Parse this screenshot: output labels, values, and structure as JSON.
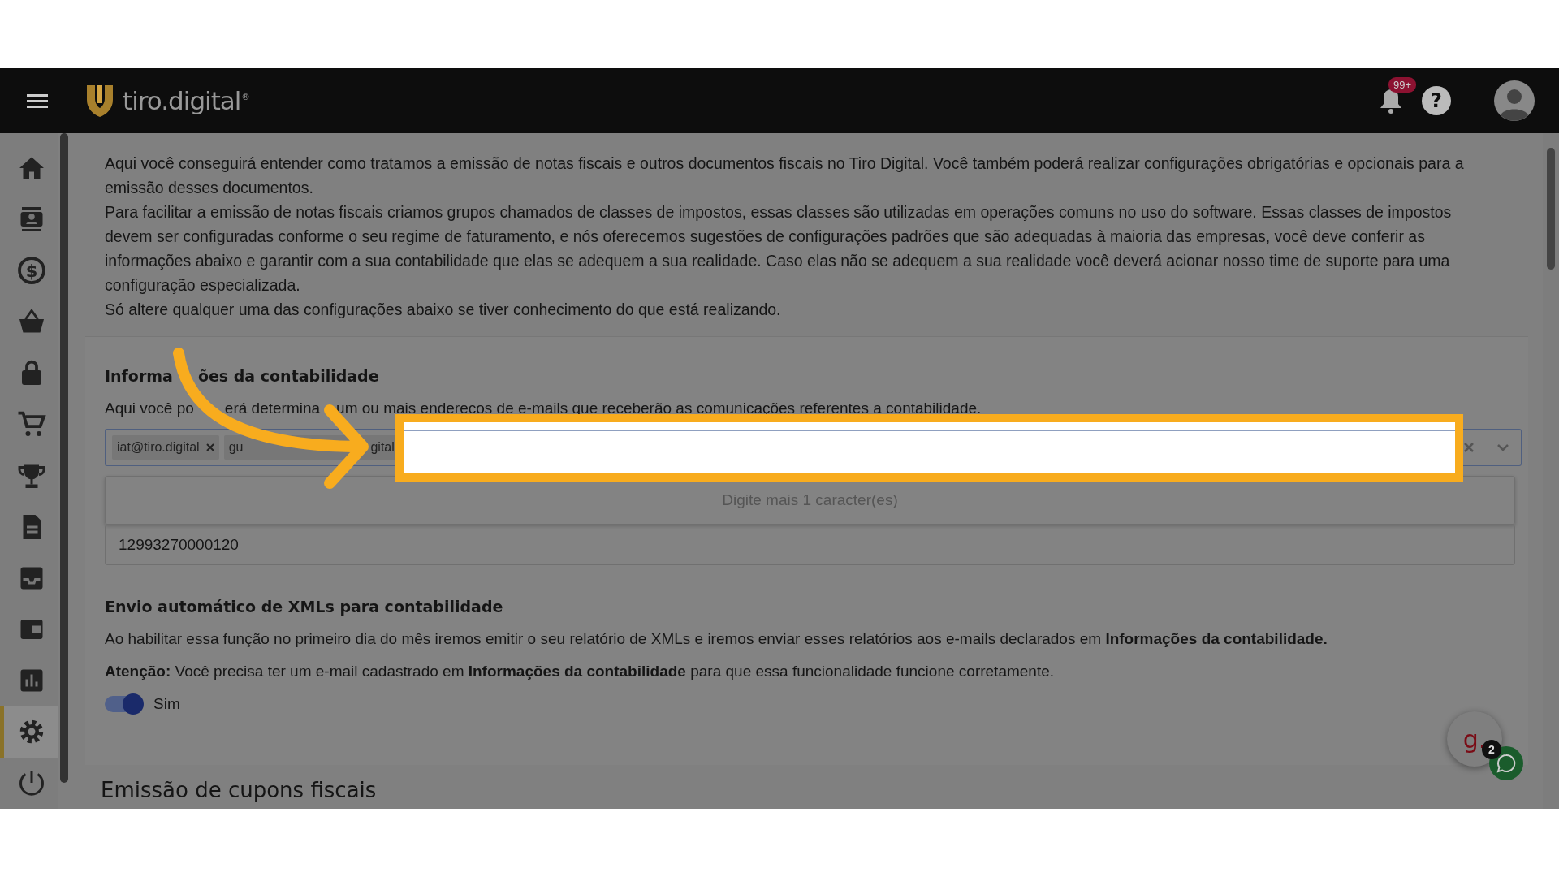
{
  "header": {
    "logo": "tiro.digital",
    "logo_mark": "®",
    "notification_badge": "99+",
    "help_glyph": "?"
  },
  "sidebar": {
    "items": [
      {
        "kind": "home",
        "selected": false
      },
      {
        "kind": "contacts",
        "selected": false
      },
      {
        "kind": "dollar",
        "selected": false,
        "glyph": "$"
      },
      {
        "kind": "basket",
        "selected": false
      },
      {
        "kind": "lock",
        "selected": false
      },
      {
        "kind": "cart",
        "selected": false
      },
      {
        "kind": "trophy",
        "selected": false
      },
      {
        "kind": "document",
        "selected": false
      },
      {
        "kind": "inbox",
        "selected": false
      },
      {
        "kind": "wallet",
        "selected": false
      },
      {
        "kind": "chart",
        "selected": false
      },
      {
        "kind": "settings",
        "selected": true
      },
      {
        "kind": "power",
        "selected": false
      }
    ]
  },
  "intro": [
    "Aqui você conseguirá entender como tratamos a emissão de notas fiscais e outros documentos fiscais no Tiro Digital. Você também poderá realizar configurações obrigatórias e opcionais para a emissão desses documentos.",
    "Para facilitar a emissão de notas fiscais criamos grupos chamados de classes de impostos, essas classes são utilizadas em operações comuns no uso do software. Essas classes de impostos devem ser configuradas conforme o seu regime de faturamento, e nós oferecemos sugestões de configurações padrões que são adequadas à maioria das empresas, você deve conferir as informações abaixo e garantir com a sua contabilidade que elas se adequem a sua realidade. Caso elas não se adequem a sua realidade você deverá acionar nosso time de suporte para uma configuração especializada.",
    "Só altere qualquer uma das configurações abaixo se tiver conhecimento do que está realizando."
  ],
  "accounting": {
    "title_parts": [
      "Informa",
      "ões da contabilidade"
    ],
    "description_parts": [
      "Aqui você po",
      "erá determina",
      "um ou mais enderecos de e-mails que receberão as comunicações referentes a contabilidade."
    ],
    "chips": [
      {
        "label_start": "iat@tiro.digital"
      },
      {
        "label_start": "gu",
        "label_end": "gital"
      }
    ],
    "dropdown_message": "Digite mais 1 caracter(es)",
    "document_value": "12993270000120"
  },
  "xml": {
    "title": "Envio automático de XMLs para contabilidade",
    "text": "Ao habilitar essa função no primeiro dia do mês iremos emitir o seu relatório de XMLs e iremos enviar esses relatórios aos e-mails declarados em **Informações da contabilidade.**",
    "warning": "**Atenção:** Você precisa ter um e-mail cadastrado em **Informações da contabilidade** para que essa funcionalidade funcione corretamente.",
    "toggle": {
      "on": true,
      "label": "Sim"
    }
  },
  "next_section_title": "Emissão de cupons fiscais",
  "chat": {
    "logo": "g.",
    "badge": "2"
  }
}
